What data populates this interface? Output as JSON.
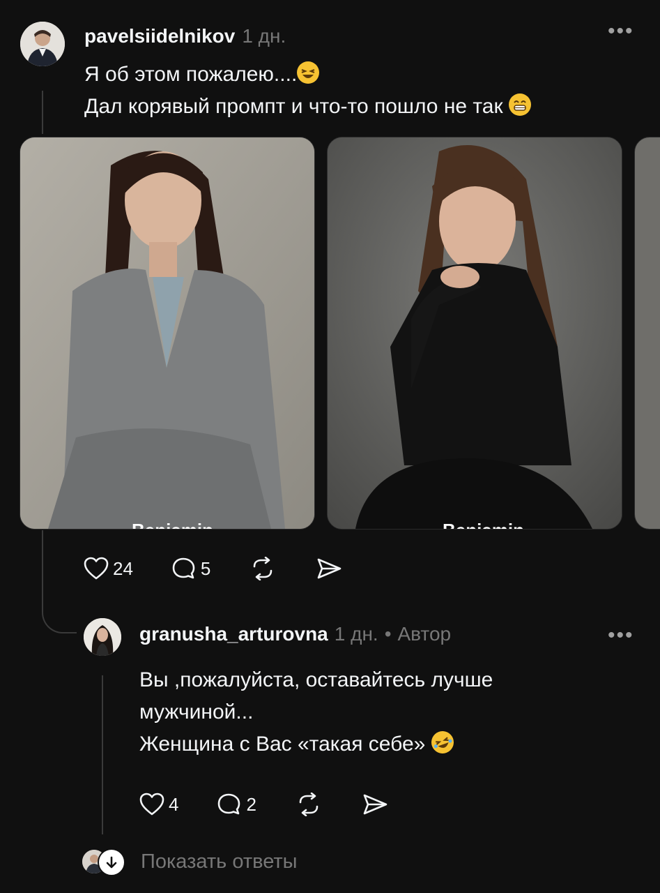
{
  "post": {
    "username": "pavelsiidelnikov",
    "time": "1 дн.",
    "lines": [
      "Я об этом пожалею....",
      "Дал корявый промпт и что-то пошло не так"
    ],
    "emojis": [
      "laughing-squint-emoji",
      "grinning-emoji"
    ],
    "media_captions": [
      "Benjamin",
      "Benjamin"
    ],
    "actions": {
      "likes": "24",
      "replies": "5"
    }
  },
  "reply": {
    "username": "granusha_arturovna",
    "time": "1 дн.",
    "separator": "•",
    "author_badge": "Автор",
    "lines": [
      "Вы ,пожалуйста, оставайтесь лучше",
      "мужчиной...",
      "Женщина с Вас «такая себе»"
    ],
    "emoji": "rofl-emoji",
    "actions": {
      "likes": "4",
      "replies": "2"
    }
  },
  "show_replies": {
    "label": "Показать ответы"
  },
  "icons": [
    "more-icon",
    "heart-icon",
    "comment-icon",
    "repost-icon",
    "share-icon",
    "arrow-down-icon"
  ],
  "colors": {
    "background": "#101010",
    "text": "#f3f5f7",
    "muted": "#777777",
    "emoji": "#f6c232"
  }
}
